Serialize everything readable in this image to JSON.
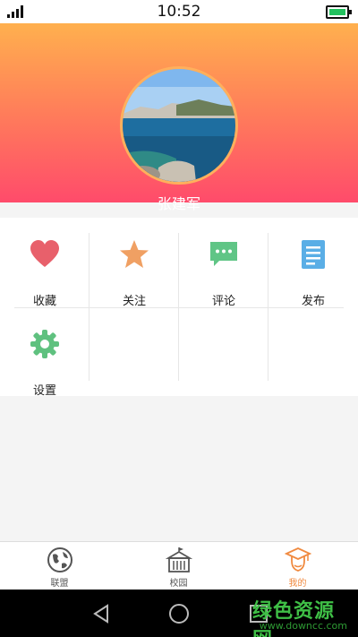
{
  "status_bar": {
    "time": "10:52",
    "battery_color": "#22c15e"
  },
  "profile": {
    "username": "张建军"
  },
  "grid": {
    "items": [
      {
        "label": "收藏",
        "icon": "heart-icon",
        "color": "#e8606b"
      },
      {
        "label": "关注",
        "icon": "star-icon",
        "color": "#f0a063"
      },
      {
        "label": "评论",
        "icon": "comment-icon",
        "color": "#60c586"
      },
      {
        "label": "发布",
        "icon": "document-icon",
        "color": "#5aaee6"
      },
      {
        "label": "设置",
        "icon": "gear-icon",
        "color": "#5fc17f"
      }
    ]
  },
  "tabs": [
    {
      "label": "联盟",
      "icon": "globe-icon",
      "active": false
    },
    {
      "label": "校园",
      "icon": "building-icon",
      "active": false
    },
    {
      "label": "我的",
      "icon": "graduate-icon",
      "active": true
    }
  ],
  "watermark": {
    "text": "绿色资源网",
    "url": "www.downcc.com"
  }
}
